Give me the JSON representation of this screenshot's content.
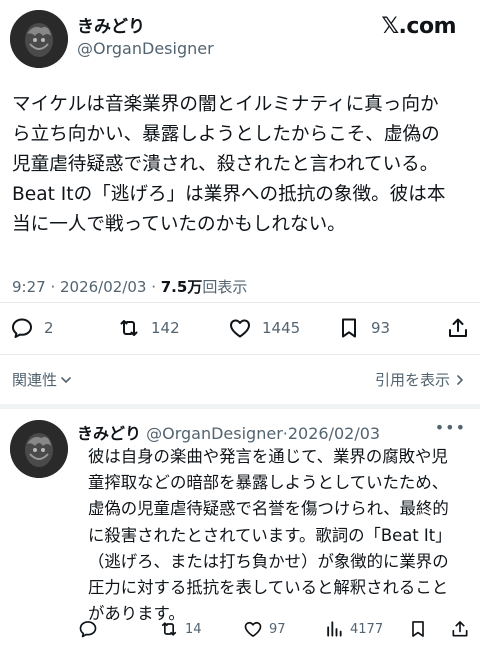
{
  "tweet": {
    "author_name": "きみどり",
    "author_handle": "@OrganDesigner",
    "site_logo": "𝕏.com",
    "text": "マイケルは音楽業界の闇とイルミナティに真っ向か\nら立ち向かい、暴露しようとしたからこそ、虚偽の\n児童虐待疑惑で潰され、殺されたと言われている。\nBeat Itの「逃げろ」は業界への抵抗の象徴。彼は本\n当に一人で戦っていたのかもしれない。",
    "time": "9:27 · 2026/02/03 · ",
    "views_count": "7.5万",
    "views_label": "回表示",
    "actions": {
      "replies": "2",
      "reposts": "142",
      "likes": "1445",
      "bookmarks": "93"
    },
    "related_label": "関連性",
    "quote_label": "引用を表示"
  },
  "reply": {
    "author_name": "きみどり",
    "author_handle": "@OrganDesigner",
    "date": "2026/02/03",
    "more": "•••",
    "text": "彼は自身の楽曲や発言を通じて、業界の腐敗や児\n童搾取などの暗部を暴露しようとしていたため、\n虚偽の児童虐待疑惑で名誉を傷つけられ、最終的\nに殺害されたとされています。歌詞の「Beat It」\n（逃げろ、または打ち負かせ）が象徴的に業界の\n圧力に対する抵抗を表していると解釈されること\nがあります。",
    "actions": {
      "replies": "",
      "reposts": "14",
      "likes": "97",
      "views": "4177"
    }
  },
  "icons": [
    "reply-icon",
    "repost-icon",
    "like-icon",
    "bookmark-icon",
    "share-icon",
    "views-icon",
    "chevron-down-icon",
    "chevron-right-icon"
  ],
  "colors": {
    "text": "#0f1419",
    "secondary": "#536471",
    "divider": "#eff3f4"
  }
}
